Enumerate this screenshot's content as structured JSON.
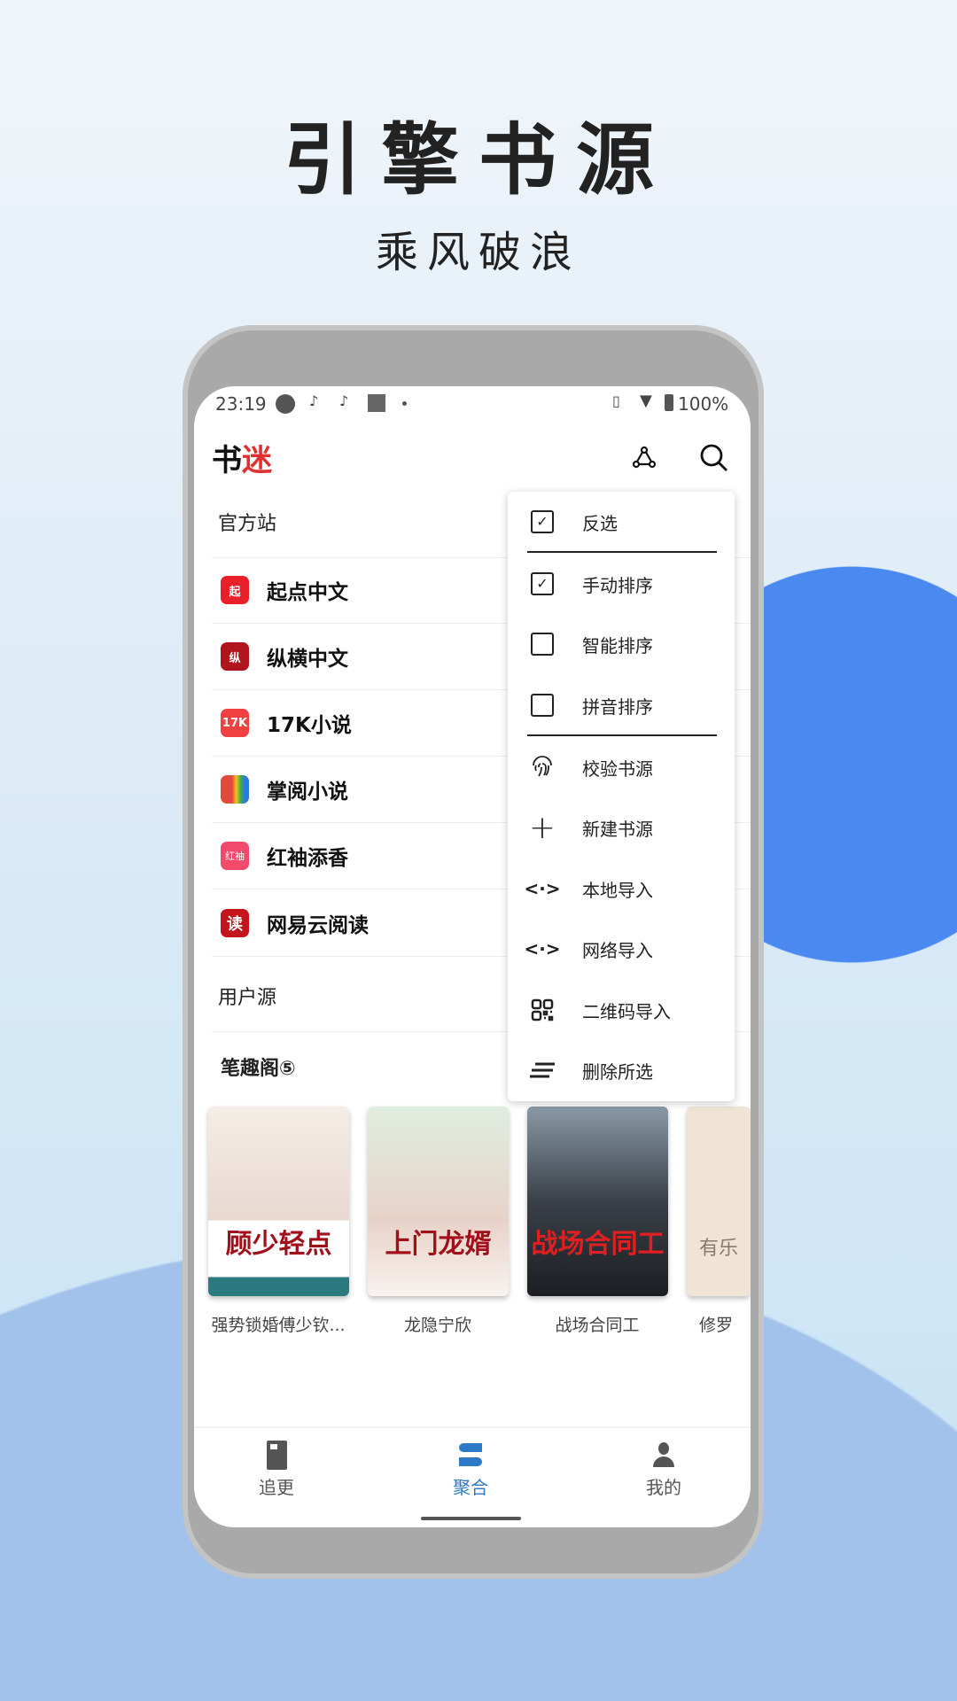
{
  "promo": {
    "title": "引擎书源",
    "subtitle": "乘风破浪"
  },
  "status_bar": {
    "time": "23:19",
    "battery": "100%",
    "icons": [
      "app-icon",
      "tiktok-icon",
      "tiktok-icon",
      "square-icon",
      "dot-icon",
      "vibrate-icon",
      "wifi-icon",
      "battery-icon"
    ]
  },
  "app_bar": {
    "logo_text": "书迷",
    "icons": [
      "share-icon",
      "search-icon"
    ]
  },
  "sections": {
    "official": "官方站",
    "official_items": [
      {
        "label": "起点中文",
        "icon_text": "起",
        "color": "#e8202a"
      },
      {
        "label": "纵横中文",
        "icon_text": "纵",
        "color": "#b0141c"
      },
      {
        "label": "17K小说",
        "icon_text": "17K",
        "color": "#f04040"
      },
      {
        "label": "掌阅小说",
        "icon_text": "",
        "color": "#e04a3c"
      },
      {
        "label": "红袖添香",
        "icon_text": "红袖",
        "color": "#f24a6a"
      },
      {
        "label": "网易云阅读",
        "icon_text": "读",
        "color": "#c4141c"
      }
    ],
    "user": "用户源",
    "biquge": "笔趣阁⑤"
  },
  "books": [
    {
      "title": "强势锁婚傅少钦...",
      "cover_text": "顾少轻点"
    },
    {
      "title": "龙隐宁欣",
      "cover_text": "上门龙婿"
    },
    {
      "title": "战场合同工",
      "cover_text": "战场合同工"
    },
    {
      "title": "修罗",
      "cover_text": "有乐"
    }
  ],
  "menu": {
    "items": [
      {
        "label": "反选",
        "type": "checkbox",
        "checked": true
      },
      {
        "label": "手动排序",
        "type": "checkbox",
        "checked": true
      },
      {
        "label": "智能排序",
        "type": "checkbox",
        "checked": false
      },
      {
        "label": "拼音排序",
        "type": "checkbox",
        "checked": false
      },
      {
        "label": "校验书源",
        "icon": "fingerprint-icon"
      },
      {
        "label": "新建书源",
        "icon": "plus-icon"
      },
      {
        "label": "本地导入",
        "icon": "code-icon"
      },
      {
        "label": "网络导入",
        "icon": "code-icon"
      },
      {
        "label": "二维码导入",
        "icon": "qr-code-icon"
      },
      {
        "label": "删除所选",
        "icon": "delete-lines-icon"
      }
    ]
  },
  "bottom_nav": {
    "items": [
      {
        "label": "追更",
        "active": false
      },
      {
        "label": "聚合",
        "active": true
      },
      {
        "label": "我的",
        "active": false
      }
    ],
    "active_color": "#2e78c8"
  }
}
